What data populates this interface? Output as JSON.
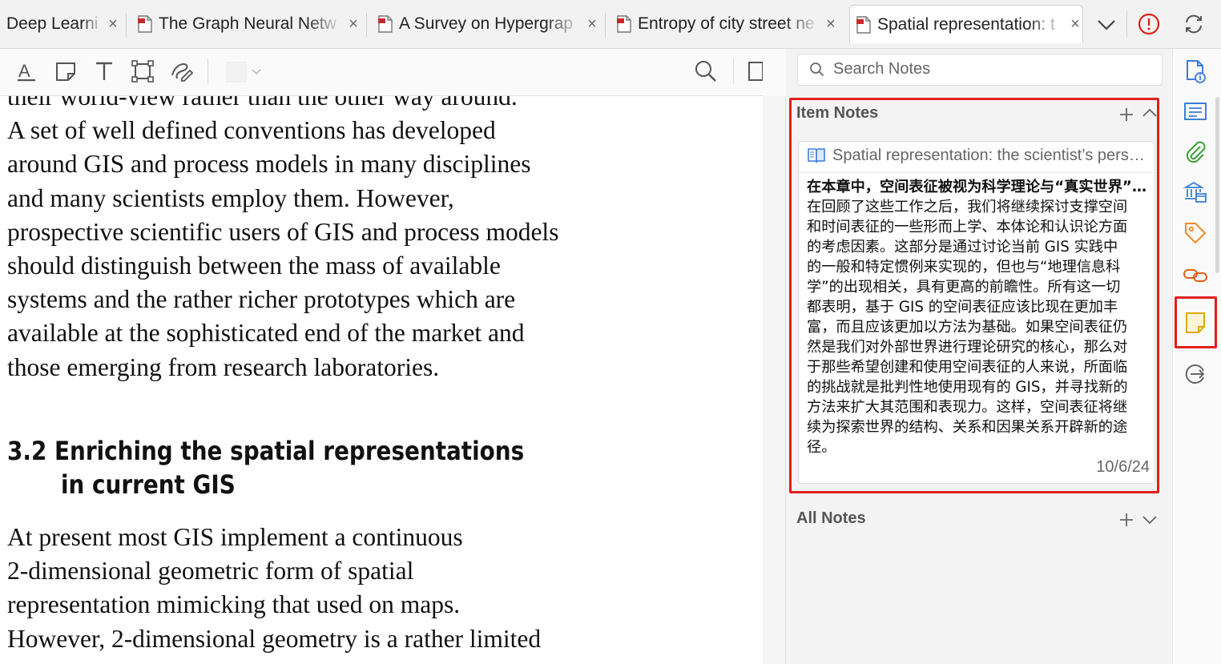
{
  "tabs": [
    {
      "label": "Deep Learni",
      "active": false
    },
    {
      "label": "The Graph Neural Netw",
      "active": false
    },
    {
      "label": "A Survey on Hypergrap",
      "active": false
    },
    {
      "label": "Entropy of city street ne",
      "active": false
    },
    {
      "label": "Spatial representation: t",
      "active": true
    }
  ],
  "tab_close_glyph": "×",
  "toolbar": {
    "tools": [
      "text-highlight-icon",
      "note-icon",
      "text-icon",
      "area-select-icon",
      "ink-icon"
    ],
    "color": "#f2f2f2"
  },
  "document": {
    "para1": [
      "their world-view rather than the other way around.",
      "A set of well defined conventions has developed",
      "around GIS and process models in many disciplines",
      "and many scientists employ them. However,",
      "prospective scientific users of GIS and process models",
      "should distinguish between the mass of available",
      "systems and the rather richer prototypes which are",
      "available at the sophisticated end of the market and",
      "those emerging from research laboratories."
    ],
    "heading_line1": "3.2  Enriching the spatial representations",
    "heading_line2": "in current GIS",
    "para2": [
      "At present most GIS implement a continuous",
      "2-dimensional geometric form of spatial",
      "representation mimicking that used on maps.",
      "However, 2-dimensional geometry is a rather limited"
    ]
  },
  "notes": {
    "search_placeholder": "Search Notes",
    "item_notes_title": "Item Notes",
    "all_notes_title": "All Notes",
    "card": {
      "parent_title": "Spatial representation: the scientist’s perspective",
      "note_title": "在本章中，空间表征被视为科学理论与“真实世界”之间的桥梁",
      "note_lines": [
        "在回顾了这些工作之后，我们将继续探讨支撑空间",
        "和时间表征的一些形而上学、本体论和认识论方面",
        "的考虑因素。这部分是通过讨论当前 GIS 实践中",
        "的一般和特定惯例来实现的，但也与“地理信息科",
        "学”的出现相关，具有更高的前瞻性。所有这一切",
        "都表明，基于 GIS 的空间表征应该比现在更加丰",
        "富，而且应该更加以方法为基础。如果空间表征仍",
        "然是我们对外部世界进行理论研究的核心，那么对",
        "于那些希望创建和使用空间表征的人来说，所面临",
        "的挑战就是批判性地使用现有的 GIS，并寻找新的",
        "方法来扩大其范围和表现力。这样，空间表征将继",
        "续为探索世界的结构、关系和因果关系开辟新的途",
        "径。"
      ],
      "date": "10/6/24"
    }
  },
  "rail": [
    "item-info-icon",
    "abstract-icon",
    "attachments-icon",
    "libraries-collections-icon",
    "tags-icon",
    "related-icon",
    "notes-icon",
    "locate-icon"
  ],
  "colors": {
    "highlight_red": "#e0201c",
    "accent_blue": "#3b7dd8",
    "pdf_red": "#c62828"
  }
}
